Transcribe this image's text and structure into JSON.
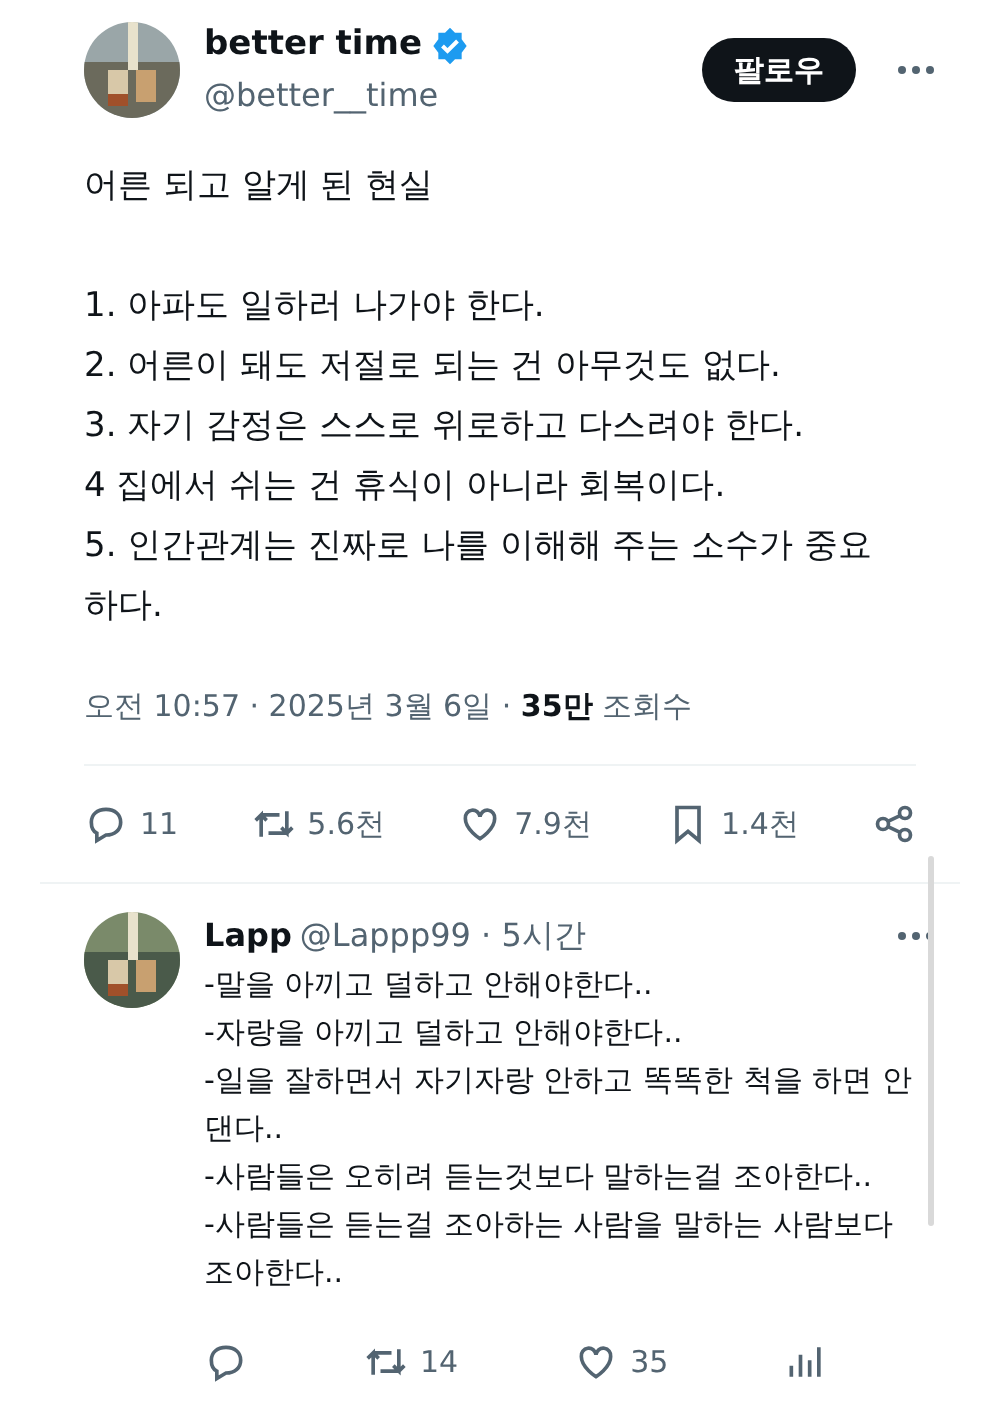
{
  "tweet": {
    "author": {
      "name": "better time",
      "handle": "@better__time",
      "verified": true
    },
    "follow_button": "팔로우",
    "title": "어른 되고 알게 된 현실",
    "lines": [
      "1. 아파도 일하러 나가야 한다.",
      "2. 어른이 돼도 저절로 되는 건 아무것도 없다.",
      "3. 자기 감정은 스스로 위로하고 다스려야 한다.",
      "4 집에서 쉬는 건 휴식이 아니라 회복이다.",
      "5. 인간관계는 진짜로 나를 이해해 주는 소수가 중요하다."
    ],
    "meta": {
      "time": "오전 10:57 · 2025년 3월 6일 · ",
      "views": "35만",
      "views_label": " 조회수"
    },
    "actions": {
      "replies": "11",
      "reposts": "5.6천",
      "likes": "7.9천",
      "bookmarks": "1.4천"
    }
  },
  "reply": {
    "name": "Lapp",
    "handle": "@Lappp99 · 5시간",
    "lines": [
      "-말을 아끼고 덜하고 안해야한다..",
      "-자랑을 아끼고 덜하고 안해야한다..",
      "-일을 잘하면서 자기자랑 안하고 똑똑한 척을 하면 안 댄다..",
      "-사람들은 오히려 듣는것보다 말하는걸 조아한다..",
      "-사람들은 듣는걸 조아하는 사람을 말하는 사람보다 조아한다.."
    ],
    "actions": {
      "reposts": "14",
      "likes": "35"
    }
  }
}
